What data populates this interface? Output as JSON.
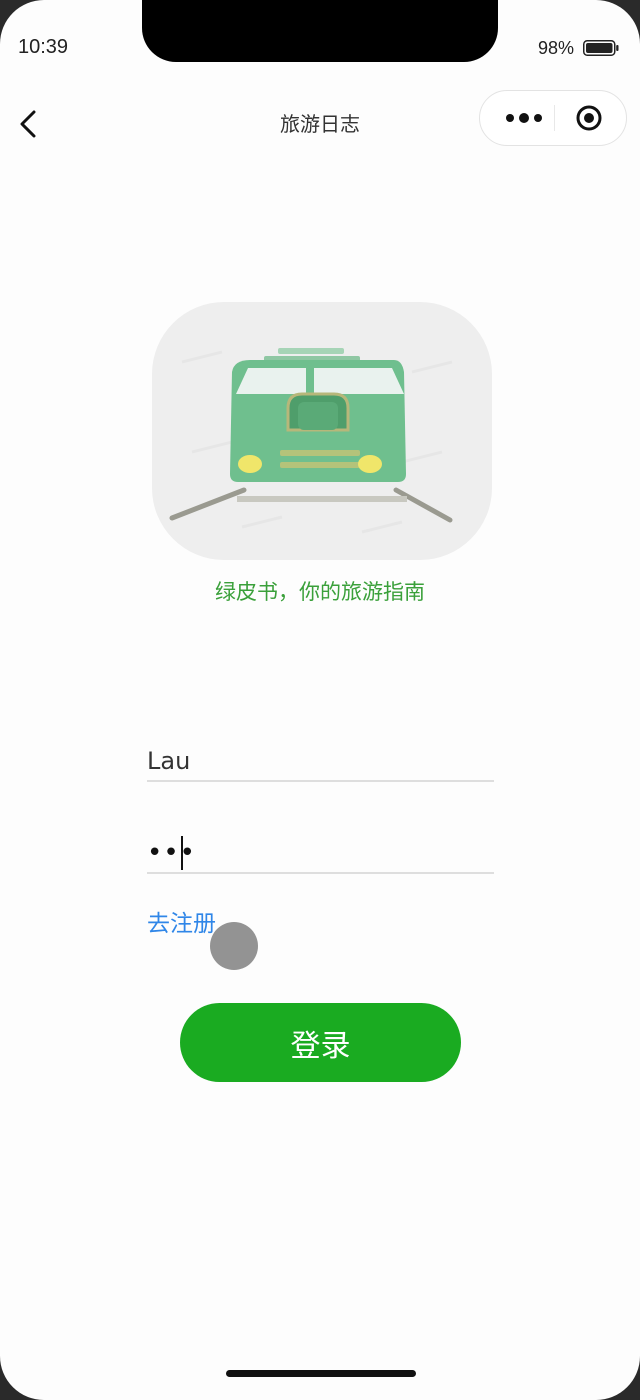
{
  "status_bar": {
    "time": "10:39",
    "battery": "98%"
  },
  "nav": {
    "title": "旅游日志",
    "back_icon": "chevron-left-icon",
    "more_icon": "more-dots-icon",
    "close_icon": "target-close-icon"
  },
  "branding": {
    "logo_icon": "train-icon",
    "slogan": "绿皮书，你的旅游指南"
  },
  "form": {
    "username_value": "Lau",
    "password_masked": "•••",
    "register_link": "去注册",
    "login_button": "登录"
  },
  "colors": {
    "brand_green": "#1aab21",
    "slogan_green": "#3aa03a",
    "link_blue": "#2f86e8",
    "train_body": "#6fbf8e"
  }
}
